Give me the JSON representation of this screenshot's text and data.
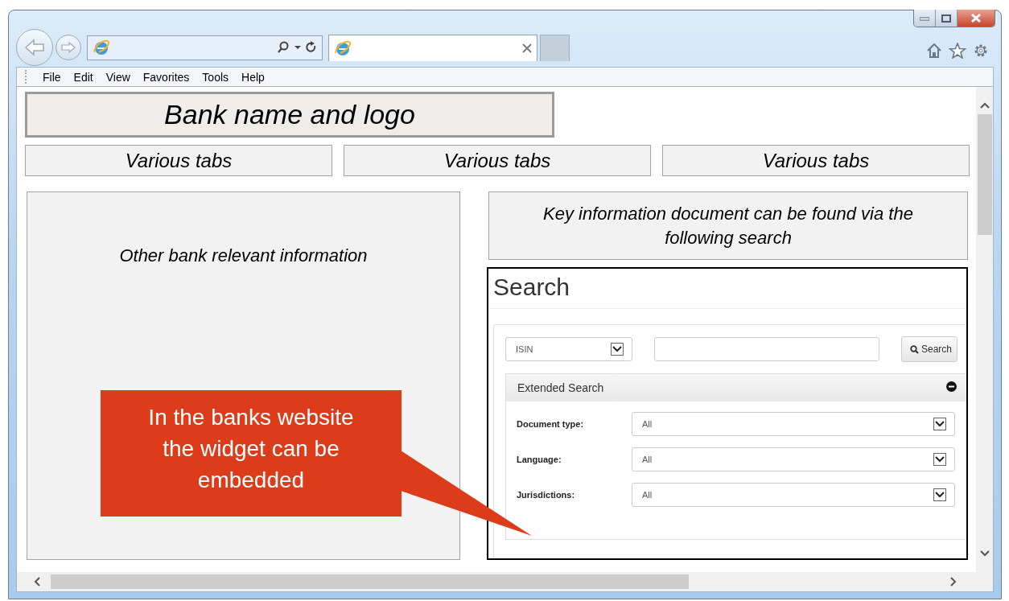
{
  "browser": {
    "menu": [
      "File",
      "Edit",
      "View",
      "Favorites",
      "Tools",
      "Help"
    ]
  },
  "page": {
    "logo_text": "Bank name and logo",
    "tabs": [
      "Various tabs",
      "Various tabs",
      "Various tabs"
    ],
    "left_panel": "Other bank relevant information",
    "key_info": "Key information document can be found via the following search",
    "widget": {
      "title": "Search",
      "id_type": "ISIN",
      "search_button": "Search",
      "extended": {
        "title": "Extended Search",
        "expanded": true,
        "filters": [
          {
            "label": "Document type:",
            "value": "All"
          },
          {
            "label": "Language:",
            "value": "All"
          },
          {
            "label": "Jurisdictions:",
            "value": "All"
          }
        ]
      }
    },
    "callout": "In the banks website the widget can be embedded"
  }
}
